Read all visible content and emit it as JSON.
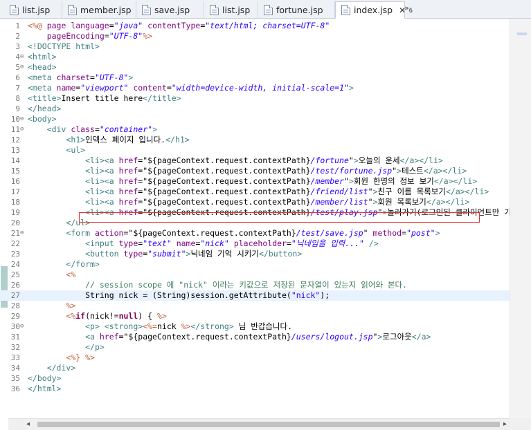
{
  "tabs": [
    {
      "label": "list.jsp",
      "active": false
    },
    {
      "label": "member.jsp",
      "active": false
    },
    {
      "label": "save.jsp",
      "active": false
    },
    {
      "label": "list.jsp",
      "active": false
    },
    {
      "label": "fortune.jsp",
      "active": false
    },
    {
      "label": "index.jsp",
      "active": true
    }
  ],
  "close_glyph": "✕",
  "overflow": {
    "glyph": "»",
    "count": "6"
  },
  "editor": {
    "current_line": 27,
    "highlighted_line": 18,
    "lines": [
      {
        "n": "1",
        "fold": "",
        "tokens": [
          [
            "dir",
            "<%@ "
          ],
          [
            "attr",
            "page "
          ],
          [
            "attr",
            "language"
          ],
          [
            "plain",
            "="
          ],
          [
            "str",
            "\"java\""
          ],
          [
            "plain",
            " "
          ],
          [
            "attr",
            "contentType"
          ],
          [
            "plain",
            "="
          ],
          [
            "str",
            "\"text/html; charset=UTF-8\""
          ]
        ]
      },
      {
        "n": "2",
        "fold": "",
        "tokens": [
          [
            "plain",
            "    "
          ],
          [
            "attr",
            "pageEncoding"
          ],
          [
            "plain",
            "="
          ],
          [
            "str",
            "\"UTF-8\""
          ],
          [
            "dir",
            "%>"
          ]
        ]
      },
      {
        "n": "3",
        "fold": "",
        "tokens": [
          [
            "tag",
            "<!DOCTYPE html>"
          ]
        ]
      },
      {
        "n": "4",
        "fold": "⊖",
        "tokens": [
          [
            "tag",
            "<html>"
          ]
        ]
      },
      {
        "n": "5",
        "fold": "⊖",
        "tokens": [
          [
            "tag",
            "<head>"
          ]
        ]
      },
      {
        "n": "6",
        "fold": "",
        "tokens": [
          [
            "tag",
            "<meta "
          ],
          [
            "attr",
            "charset"
          ],
          [
            "plain",
            "="
          ],
          [
            "str",
            "\"UTF-8\""
          ],
          [
            "tag",
            ">"
          ]
        ]
      },
      {
        "n": "7",
        "fold": "",
        "tokens": [
          [
            "tag",
            "<meta "
          ],
          [
            "attr",
            "name"
          ],
          [
            "plain",
            "="
          ],
          [
            "str",
            "\"viewport\""
          ],
          [
            "plain",
            " "
          ],
          [
            "attr",
            "content"
          ],
          [
            "plain",
            "="
          ],
          [
            "str",
            "\"width=device-width, initial-scale=1\""
          ],
          [
            "tag",
            ">"
          ]
        ]
      },
      {
        "n": "8",
        "fold": "",
        "tokens": [
          [
            "tag",
            "<title>"
          ],
          [
            "plain",
            "Insert title here"
          ],
          [
            "tag",
            "</title>"
          ]
        ]
      },
      {
        "n": "9",
        "fold": "",
        "tokens": [
          [
            "tag",
            "</head>"
          ]
        ]
      },
      {
        "n": "10",
        "fold": "⊖",
        "tokens": [
          [
            "tag",
            "<body>"
          ]
        ]
      },
      {
        "n": "11",
        "fold": "⊖",
        "tokens": [
          [
            "plain",
            "    "
          ],
          [
            "tag",
            "<div "
          ],
          [
            "attr",
            "class"
          ],
          [
            "plain",
            "="
          ],
          [
            "str",
            "\"container\""
          ],
          [
            "tag",
            ">"
          ]
        ]
      },
      {
        "n": "12",
        "fold": "",
        "tokens": [
          [
            "plain",
            "        "
          ],
          [
            "tag",
            "<h1>"
          ],
          [
            "plain",
            "인덱스 페이지 입니다."
          ],
          [
            "tag",
            "</h1>"
          ]
        ]
      },
      {
        "n": "13",
        "fold": "",
        "tokens": [
          [
            "plain",
            "        "
          ],
          [
            "tag",
            "<ul>"
          ]
        ]
      },
      {
        "n": "14",
        "fold": "",
        "tokens": [
          [
            "plain",
            "            "
          ],
          [
            "tag",
            "<li><a "
          ],
          [
            "attr",
            "href"
          ],
          [
            "plain",
            "=\"${pageContext.request.contextPath}"
          ],
          [
            "str",
            "/fortune"
          ],
          [
            "plain",
            "\""
          ],
          [
            "tag",
            ">"
          ],
          [
            "plain",
            "오늘의 운세"
          ],
          [
            "tag",
            "</a></li>"
          ]
        ]
      },
      {
        "n": "15",
        "fold": "",
        "tokens": [
          [
            "plain",
            "            "
          ],
          [
            "tag",
            "<li><a "
          ],
          [
            "attr",
            "href"
          ],
          [
            "plain",
            "=\"${pageContext.request.contextPath}"
          ],
          [
            "str",
            "/test/fortune.jsp"
          ],
          [
            "plain",
            "\""
          ],
          [
            "tag",
            ">"
          ],
          [
            "plain",
            "테스트"
          ],
          [
            "tag",
            "</a></li>"
          ]
        ]
      },
      {
        "n": "16",
        "fold": "",
        "tokens": [
          [
            "plain",
            "            "
          ],
          [
            "tag",
            "<li><a "
          ],
          [
            "attr",
            "href"
          ],
          [
            "plain",
            "=\"${pageContext.request.contextPath}"
          ],
          [
            "str",
            "/member"
          ],
          [
            "plain",
            "\""
          ],
          [
            "tag",
            ">"
          ],
          [
            "plain",
            "회원 한명의 정보 보기"
          ],
          [
            "tag",
            "</a></li>"
          ]
        ]
      },
      {
        "n": "17",
        "fold": "",
        "tokens": [
          [
            "plain",
            "            "
          ],
          [
            "tag",
            "<li><a "
          ],
          [
            "attr",
            "href"
          ],
          [
            "plain",
            "=\"${pageContext.request.contextPath}"
          ],
          [
            "str",
            "/friend/list"
          ],
          [
            "plain",
            "\""
          ],
          [
            "tag",
            ">"
          ],
          [
            "plain",
            "친구 이름 목록보기"
          ],
          [
            "tag",
            "</a></li>"
          ]
        ]
      },
      {
        "n": "18",
        "fold": "",
        "tokens": [
          [
            "plain",
            "            "
          ],
          [
            "tag",
            "<li><a "
          ],
          [
            "attr",
            "href"
          ],
          [
            "plain",
            "=\"${pageContext.request.contextPath}"
          ],
          [
            "str",
            "/member/list"
          ],
          [
            "plain",
            "\""
          ],
          [
            "tag",
            ">"
          ],
          [
            "plain",
            "회원 목록보기"
          ],
          [
            "tag",
            "</a></li>"
          ]
        ]
      },
      {
        "n": "19",
        "fold": "",
        "tokens": [
          [
            "plain",
            "            "
          ],
          [
            "tag",
            "<li><a "
          ],
          [
            "attr",
            "href"
          ],
          [
            "plain",
            "=\"${pageContext.request.contextPath}"
          ],
          [
            "str",
            "/test/play.jsp"
          ],
          [
            "plain",
            "\""
          ],
          [
            "tag",
            ">"
          ],
          [
            "plain",
            "놀러가기(로그인된 클라이언트만 가"
          ]
        ]
      },
      {
        "n": "20",
        "fold": "",
        "tokens": [
          [
            "plain",
            "        "
          ],
          [
            "tag",
            "</ul>"
          ]
        ]
      },
      {
        "n": "21",
        "fold": "⊖",
        "tokens": [
          [
            "plain",
            "        "
          ],
          [
            "tag",
            "<form "
          ],
          [
            "attr",
            "action"
          ],
          [
            "plain",
            "=\"${pageContext.request.contextPath}"
          ],
          [
            "str",
            "/test/save.jsp"
          ],
          [
            "plain",
            "\" "
          ],
          [
            "attr",
            "method"
          ],
          [
            "plain",
            "="
          ],
          [
            "str",
            "\"post\""
          ],
          [
            "tag",
            ">"
          ]
        ]
      },
      {
        "n": "22",
        "fold": "",
        "tokens": [
          [
            "plain",
            "            "
          ],
          [
            "tag",
            "<input "
          ],
          [
            "attr",
            "type"
          ],
          [
            "plain",
            "="
          ],
          [
            "str",
            "\"text\""
          ],
          [
            "plain",
            " "
          ],
          [
            "attr",
            "name"
          ],
          [
            "plain",
            "="
          ],
          [
            "str",
            "\"nick\""
          ],
          [
            "plain",
            " "
          ],
          [
            "attr",
            "placeholder"
          ],
          [
            "plain",
            "="
          ],
          [
            "str",
            "\"닉네임을 입력...\""
          ],
          [
            "plain",
            " "
          ],
          [
            "tag",
            "/>"
          ]
        ]
      },
      {
        "n": "23",
        "fold": "",
        "tokens": [
          [
            "plain",
            "            "
          ],
          [
            "tag",
            "<button "
          ],
          [
            "attr",
            "type"
          ],
          [
            "plain",
            "="
          ],
          [
            "str",
            "\"submit\""
          ],
          [
            "tag",
            ">"
          ],
          [
            "plain",
            "닉네임 기억 시키기"
          ],
          [
            "tag",
            "</button>"
          ]
        ]
      },
      {
        "n": "24",
        "fold": "",
        "tokens": [
          [
            "plain",
            "        "
          ],
          [
            "tag",
            "</form>"
          ]
        ]
      },
      {
        "n": "25",
        "fold": "",
        "tokens": [
          [
            "plain",
            "        "
          ],
          [
            "dir",
            "<%"
          ]
        ]
      },
      {
        "n": "26",
        "fold": "",
        "tokens": [
          [
            "plain",
            "            "
          ],
          [
            "comment",
            "// session scope 에 \"nick\" 이라는 키값으로 저장된 문자열이 있는지 읽어와 본다."
          ]
        ]
      },
      {
        "n": "27",
        "fold": "",
        "tokens": [
          [
            "plain",
            "            String nick = (String)session.getAttribute("
          ],
          [
            "javastr",
            "\"nick\""
          ],
          [
            "plain",
            ");"
          ]
        ]
      },
      {
        "n": "28",
        "fold": "",
        "tokens": [
          [
            "plain",
            "        "
          ],
          [
            "dir",
            "%>"
          ]
        ]
      },
      {
        "n": "29",
        "fold": "",
        "tokens": [
          [
            "plain",
            "        "
          ],
          [
            "dir",
            "<%"
          ],
          [
            "kw",
            "if"
          ],
          [
            "plain",
            "(nick!="
          ],
          [
            "kw",
            "null"
          ],
          [
            "plain",
            ") { "
          ],
          [
            "dir",
            "%>"
          ]
        ]
      },
      {
        "n": "30",
        "fold": "⊖",
        "tokens": [
          [
            "plain",
            "            "
          ],
          [
            "tag",
            "<p> <strong>"
          ],
          [
            "dir",
            "<%="
          ],
          [
            "plain",
            "nick "
          ],
          [
            "dir",
            "%>"
          ],
          [
            "tag",
            "</strong>"
          ],
          [
            "plain",
            " 님 반갑습니다."
          ]
        ]
      },
      {
        "n": "31",
        "fold": "",
        "tokens": [
          [
            "plain",
            "            "
          ],
          [
            "tag",
            "<a "
          ],
          [
            "attr",
            "href"
          ],
          [
            "plain",
            "=\"${pageContext.request.contextPath}"
          ],
          [
            "str",
            "/users/logout.jsp"
          ],
          [
            "plain",
            "\""
          ],
          [
            "tag",
            ">"
          ],
          [
            "plain",
            "로그아웃"
          ],
          [
            "tag",
            "</a>"
          ]
        ]
      },
      {
        "n": "32",
        "fold": "",
        "tokens": [
          [
            "plain",
            "            "
          ],
          [
            "tag",
            "</p>"
          ]
        ]
      },
      {
        "n": "33",
        "fold": "",
        "tokens": [
          [
            "plain",
            "        "
          ],
          [
            "dir",
            "<%} %>"
          ]
        ]
      },
      {
        "n": "34",
        "fold": "",
        "tokens": [
          [
            "plain",
            "    "
          ],
          [
            "tag",
            "</div>"
          ]
        ]
      },
      {
        "n": "35",
        "fold": "",
        "tokens": [
          [
            "tag",
            "</body>"
          ]
        ]
      },
      {
        "n": "36",
        "fold": "",
        "tokens": [
          [
            "tag",
            "</html>"
          ]
        ]
      }
    ]
  },
  "scrollbar": {
    "left_arrow": "◂",
    "right_arrow": "▸"
  }
}
